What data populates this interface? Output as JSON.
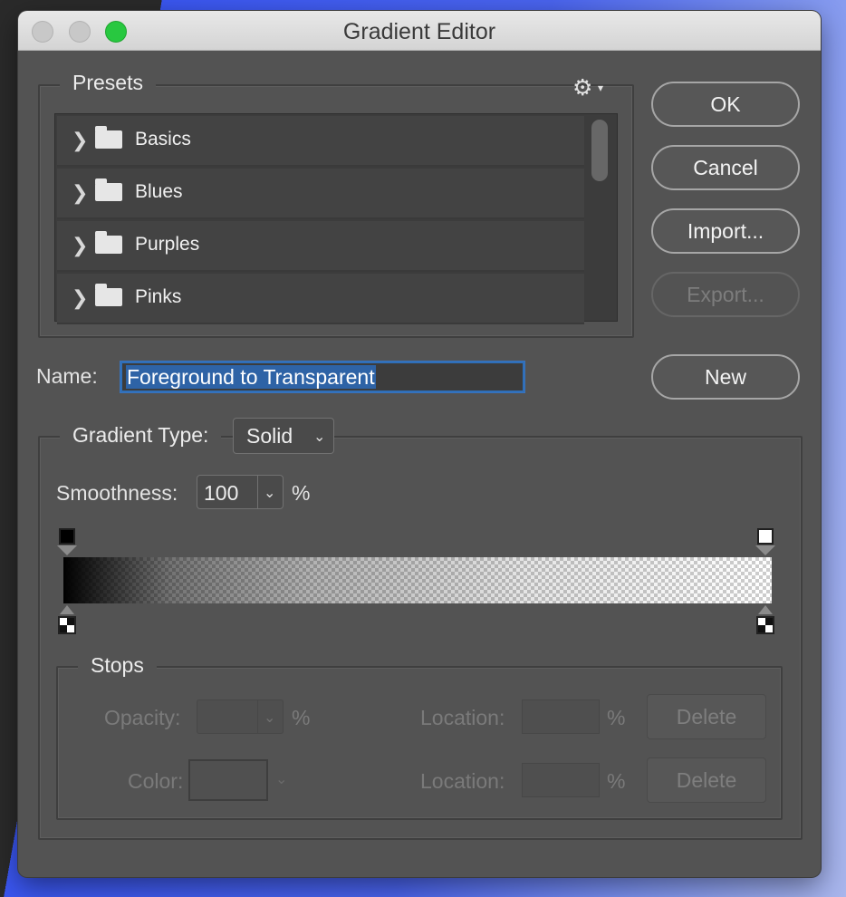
{
  "window": {
    "title": "Gradient Editor"
  },
  "presets": {
    "legend": "Presets",
    "menu_icon": "gear-icon",
    "items": [
      {
        "label": "Basics",
        "icon": "folder-icon"
      },
      {
        "label": "Blues",
        "icon": "folder-icon"
      },
      {
        "label": "Purples",
        "icon": "folder-icon"
      },
      {
        "label": "Pinks",
        "icon": "folder-icon"
      }
    ]
  },
  "buttons": {
    "ok": "OK",
    "cancel": "Cancel",
    "import": "Import...",
    "export": "Export...",
    "new": "New"
  },
  "name": {
    "label": "Name:",
    "value": "Foreground to Transparent"
  },
  "gradient_type": {
    "label": "Gradient Type:",
    "value": "Solid"
  },
  "smoothness": {
    "label": "Smoothness:",
    "value": "100",
    "unit": "%"
  },
  "stops": {
    "legend": "Stops",
    "opacity_label": "Opacity:",
    "opacity_unit": "%",
    "color_label": "Color:",
    "location_label_1": "Location:",
    "location_unit_1": "%",
    "location_label_2": "Location:",
    "location_unit_2": "%",
    "delete_1": "Delete",
    "delete_2": "Delete"
  },
  "colors": {
    "accent": "#2e63a6",
    "zoom_button": "#28c840",
    "panel": "#535353"
  }
}
